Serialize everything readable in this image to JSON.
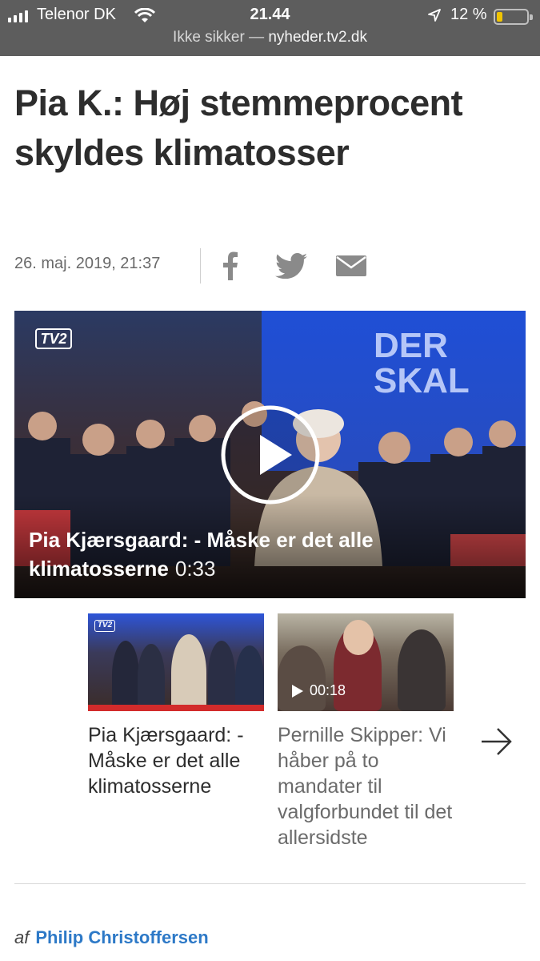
{
  "status": {
    "carrier": "Telenor DK",
    "time": "21.44",
    "battery_pct": "12 %",
    "battery_level": 0.12,
    "url_prefix": "Ikke sikker —",
    "url_domain": "nyheder.tv2.dk"
  },
  "article": {
    "headline": "Pia K.: Høj stemmeprocent skyldes klimatosser",
    "date": "26. maj. 2019, 21:37",
    "share_icons": [
      "facebook-icon",
      "twitter-icon",
      "mail-icon"
    ]
  },
  "video": {
    "logo": "TV2",
    "backdrop_text": "DER SKAL",
    "caption": "Pia Kjærsgaard: - Måske er det alle klimatosserne",
    "duration": "0:33"
  },
  "related": [
    {
      "title": "Pia Kjærsgaard: - Måske er det alle klimatosserne",
      "logo": "TV2",
      "selected": true
    },
    {
      "title": "Pernille Skipper: Vi håber på to mandater til valgforbundet til det allersidste",
      "duration": "00:18"
    }
  ],
  "byline": {
    "prefix": "af",
    "author": "Philip Christoffersen"
  },
  "colors": {
    "status_bg": "#5d5d5d",
    "author_link": "#2d79c7",
    "accent_red": "#d22b2b",
    "battery": "#f0c400"
  }
}
